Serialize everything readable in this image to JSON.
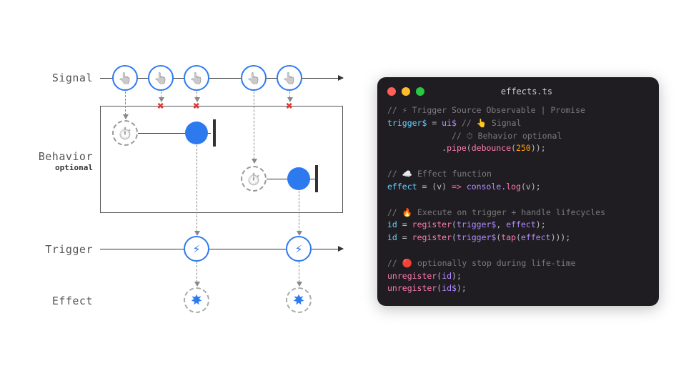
{
  "labels": {
    "signal": "Signal",
    "behavior": "Behavior",
    "behavior_sub": "optional",
    "trigger": "Trigger",
    "effect": "Effect"
  },
  "code": {
    "title": "effects.ts",
    "c1": "// ⚡ Trigger Source Observable | Promise",
    "l2a": "trigger$",
    "l2b": " = ",
    "l2c": "ui$",
    "l2d": " // 👆 Signal",
    "c3": "             // ⏱ Behavior optional",
    "l4a": "           .",
    "l4b": "pipe",
    "l4c": "(",
    "l4d": "debounce",
    "l4e": "(",
    "l4f": "250",
    "l4g": "));",
    "c5": "// ☁️ Effect function",
    "l6a": "effect",
    "l6b": " = ",
    "l6c": "(v)",
    "l6d": " => ",
    "l6e": "console",
    "l6f": ".",
    "l6g": "log",
    "l6h": "(v);",
    "c7": "// 🔥 Execute on trigger + handle lifecycles",
    "l8a": "id",
    "l8b": " = ",
    "l8c": "register",
    "l8d": "(",
    "l8e": "trigger$",
    "l8f": ", ",
    "l8g": "effect",
    "l8h": ");",
    "l9a": "id",
    "l9b": " = ",
    "l9c": "register",
    "l9d": "(",
    "l9e": "trigger$",
    "l9f": "(",
    "l9g": "tap",
    "l9h": "(",
    "l9i": "effect",
    "l9j": ")));",
    "c10": "// 🔴 optionally stop during life-time",
    "l11a": "unregister",
    "l11b": "(",
    "l11c": "id",
    "l11d": ");",
    "l12a": "unregister",
    "l12b": "(",
    "l12c": "id$",
    "l12d": ");"
  },
  "chart_data": {
    "type": "diagram",
    "rows": [
      {
        "name": "Signal",
        "events": [
          1,
          2,
          3,
          4,
          5
        ],
        "cancelled": [
          2,
          3,
          5
        ]
      },
      {
        "name": "Behavior",
        "optional": true,
        "debounce_windows": [
          {
            "start": 1,
            "emit_at": 3
          },
          {
            "start": 4,
            "emit_at": 5,
            "after_row": true
          }
        ]
      },
      {
        "name": "Trigger",
        "emits_at": [
          3,
          5
        ]
      },
      {
        "name": "Effect",
        "emits_at": [
          3,
          5
        ]
      }
    ]
  }
}
